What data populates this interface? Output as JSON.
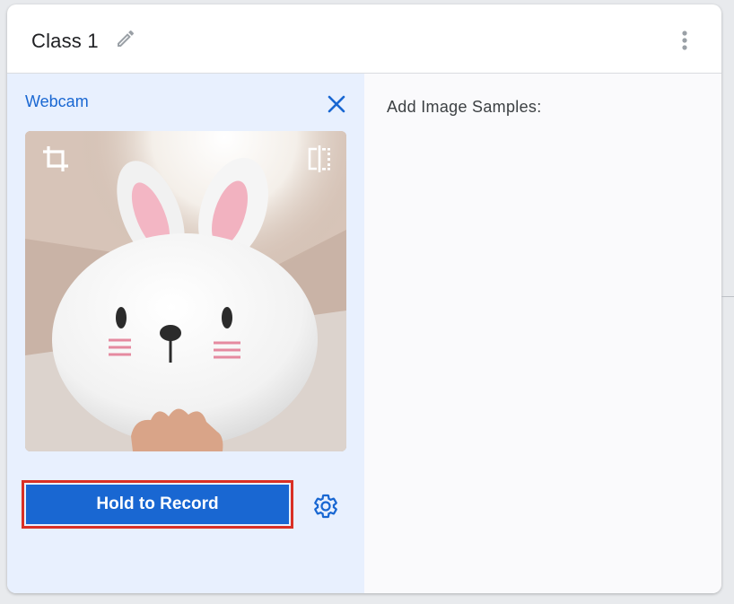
{
  "class_card": {
    "title": "Class 1",
    "edit_icon": "pencil-icon",
    "menu_icon": "more-vert-icon"
  },
  "webcam": {
    "label": "Webcam",
    "close_icon": "close-icon",
    "crop_icon": "crop-icon",
    "flip_icon": "flip-icon",
    "record_button": "Hold to Record",
    "settings_icon": "gear-icon"
  },
  "samples": {
    "label": "Add Image Samples:"
  },
  "colors": {
    "accent": "#1967d2",
    "panel_bg": "#e8f0fe",
    "highlight": "#d93025"
  }
}
